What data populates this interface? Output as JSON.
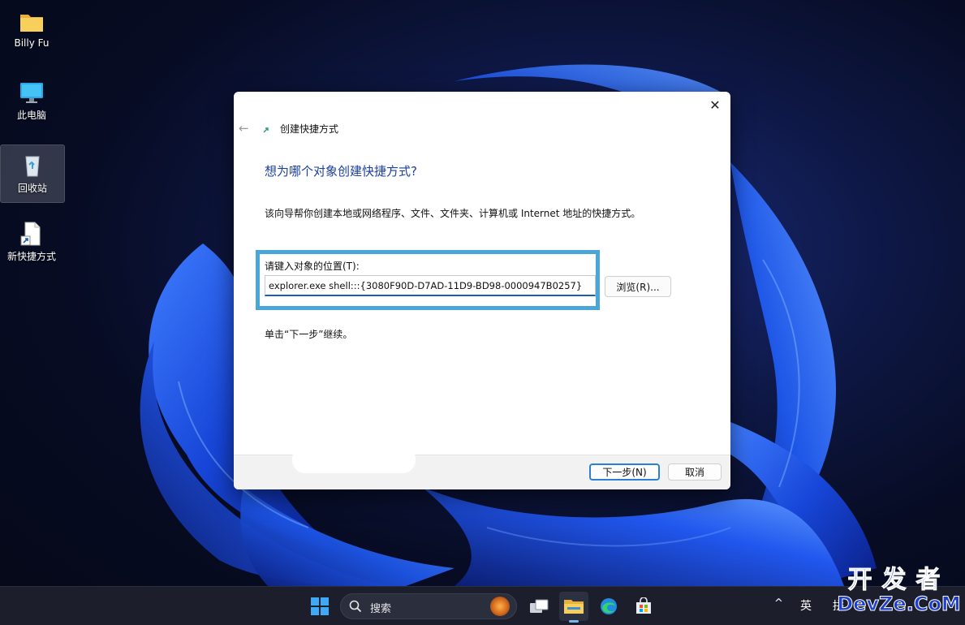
{
  "desktop": {
    "icons": [
      {
        "label": "Billy Fu",
        "icon": "folder-icon"
      },
      {
        "label": "此电脑",
        "icon": "computer-icon"
      },
      {
        "label": "回收站",
        "icon": "recycle-bin-icon"
      },
      {
        "label": "新快捷方式",
        "icon": "shortcut-file-icon"
      }
    ]
  },
  "dialog": {
    "title": "创建快捷方式",
    "heading": "想为哪个对象创建快捷方式?",
    "description": "该向导帮你创建本地或网络程序、文件、文件夹、计算机或 Internet 地址的快捷方式。",
    "location_label": "请键入对象的位置(T):",
    "location_value": "explorer.exe shell:::{3080F90D-D7AD-11D9-BD98-0000947B0257}",
    "browse_label": "浏览(R)...",
    "continue_hint": "单击“下一步”继续。",
    "next_label": "下一步(N)",
    "cancel_label": "取消",
    "close_glyph": "✕",
    "back_glyph": "←"
  },
  "taskbar": {
    "search_placeholder": "搜索",
    "tray_chevron": "^",
    "ime_language": "英",
    "ime_mode": "拼"
  },
  "watermark": {
    "top": "开发者",
    "bottom": "DevZe.CoM"
  },
  "colors": {
    "accent": "#1a5fb4",
    "highlight_border": "#4aa6d6",
    "heading": "#1a3f9c",
    "taskbar": "#1c1f2b"
  }
}
